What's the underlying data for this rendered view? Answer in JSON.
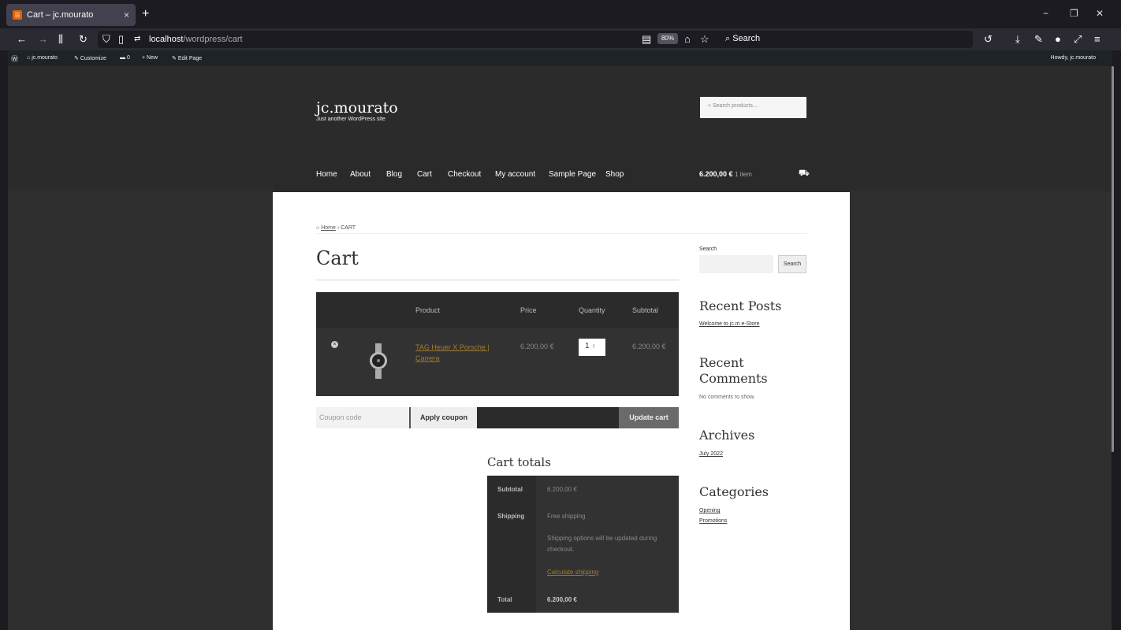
{
  "browser": {
    "tab_title": "Cart – jc.mourato",
    "tab_close": "×",
    "new_tab": "+",
    "url_host": "localhost",
    "url_path": "/wordpress/cart",
    "zoom": "80%",
    "search_placeholder": "Search",
    "window_controls": [
      "−",
      "❐",
      "✕"
    ]
  },
  "admin_bar": {
    "site_name": "jc.mourato",
    "customize": "Customize",
    "comments_count": "0",
    "new": "New",
    "edit_page": "Edit Page",
    "howdy": "Howdy, jc.mourato"
  },
  "site": {
    "title": "jc.mourato",
    "tagline": "Just another WordPress site",
    "product_search_placeholder": "Search products…"
  },
  "nav": {
    "links": [
      "Home",
      "About",
      "Blog",
      "Cart",
      "Checkout",
      "My account",
      "Sample Page",
      "Shop"
    ],
    "cart_total": "6.200,00 €",
    "cart_items": "1 item"
  },
  "breadcrumb": {
    "home": "Home",
    "current": "CART"
  },
  "page_title": "Cart",
  "cart_table": {
    "headers": {
      "product": "Product",
      "price": "Price",
      "quantity": "Quantity",
      "subtotal": "Subtotal"
    },
    "row": {
      "product": "TAG Heuer X Porsche | Carrera",
      "price": "6.200,00 €",
      "quantity": "1",
      "subtotal": "6.200,00 €"
    }
  },
  "coupon": {
    "placeholder": "Coupon code",
    "apply": "Apply coupon",
    "update": "Update cart"
  },
  "totals": {
    "title": "Cart totals",
    "subtotal_label": "Subtotal",
    "subtotal_value": "6.200,00 €",
    "shipping_label": "Shipping",
    "shipping_value": "Free shipping",
    "shipping_note": "Shipping options will be updated during checkout.",
    "calculate_shipping": "Calculate shipping",
    "total_label": "Total",
    "total_value": "6.200,00 €"
  },
  "sidebar": {
    "search_label": "Search",
    "search_button": "Search",
    "recent_posts_title": "Recent Posts",
    "recent_post": "Welcome to jc.m e-Store",
    "recent_comments_title": "Recent Comments",
    "no_comments": "No comments to show.",
    "archives_title": "Archives",
    "archive": "July 2022",
    "categories_title": "Categories",
    "categories": [
      "Opening",
      "Promotions"
    ]
  }
}
